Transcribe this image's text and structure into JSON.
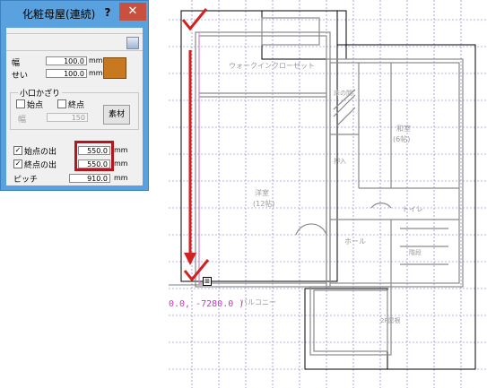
{
  "dialog": {
    "title": "化粧母屋(連続)",
    "help_label": "?",
    "close_label": "✕",
    "width_label": "幅",
    "width_value": "100.0",
    "height_label": "せい",
    "height_value": "100.0",
    "unit_mm": "mm",
    "swatch_color": "#c8781e",
    "end_group_title": "小口かざり",
    "start_label": "始点",
    "end_label": "終点",
    "start_checked": false,
    "end_checked": false,
    "group_width_label": "幅",
    "group_width_value": "150",
    "material_label": "素材",
    "start_overhang_label": "始点の出",
    "start_overhang_value": "550.0",
    "end_overhang_label": "終点の出",
    "end_overhang_value": "550.0",
    "overhang_checked": true,
    "pitch_label": "ピッチ",
    "pitch_value": "910.0"
  },
  "canvas": {
    "coordinate_readout": "0.0, -7280.0 )",
    "rooms": {
      "walkin": "ウォークインクローゼット",
      "closet": "床の間",
      "japanese": "和室",
      "japanese_size": "(6帖)",
      "storage": "押入",
      "western": "洋室",
      "western_size": "(12帖)",
      "toilet": "トイレ",
      "hall": "ホール",
      "stairs": "階段",
      "balcony": "バルコニー",
      "roof": "2F屋根"
    },
    "annotation_color": "#d32020",
    "grid_color": "#6c6cd8"
  }
}
